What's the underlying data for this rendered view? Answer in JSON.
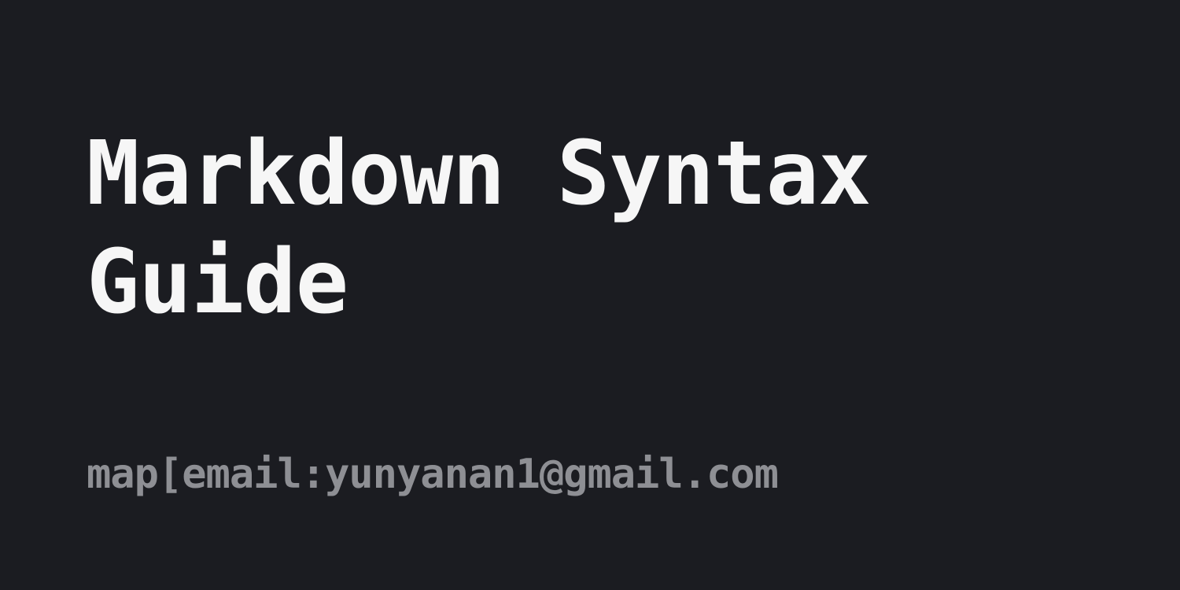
{
  "card": {
    "title_line1": "Markdown Syntax",
    "title_line2": "Guide",
    "author": "map[email:yunyanan1@gmail.com"
  },
  "colors": {
    "background": "#1b1c21",
    "title": "#f6f6f6",
    "author": "#8e8f94"
  }
}
